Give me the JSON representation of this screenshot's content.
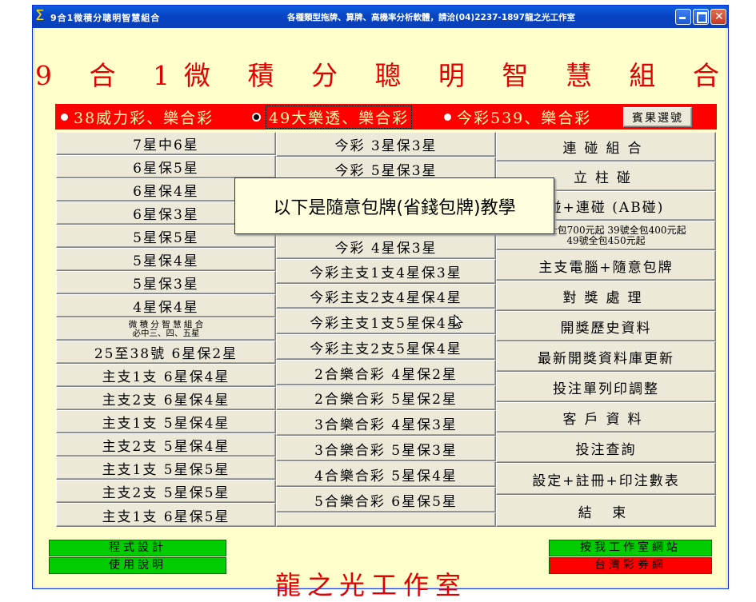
{
  "window": {
    "title": "9合1微積分聰明智慧組合",
    "subtitle": "各種類型拖牌、算牌、高機率分析軟體，請洽(04)2237-1897龍之光工作室",
    "app_icon": "sigma-icon"
  },
  "heading": "9 合 1微 積 分 聰 明 智 慧 組 合",
  "radios": [
    {
      "label": "38威力彩、樂合彩",
      "selected": false
    },
    {
      "label": "49大樂透、樂合彩",
      "selected": true
    },
    {
      "label": "今彩539、樂合彩",
      "selected": false
    }
  ],
  "result_button": "賓果選號",
  "tooltip": "以下是隨意包牌(省錢包牌)教學",
  "col1": [
    "7星中6星",
    "6星保5星",
    "6星保4星",
    "6星保3星",
    "5星保5星",
    "5星保4星",
    "5星保3星",
    "4星保4星",
    "微 積 分 智 慧 組 合",
    "必中三、四、五星",
    "25至38號 6星保2星",
    "主支1支  6星保4星",
    "主支2支  6星保4星",
    "主支1支  5星保4星",
    "主支2支  5星保4星",
    "主支1支  5星保5星",
    "主支2支  5星保5星",
    "主支1支  6星保5星"
  ],
  "col2": [
    "今彩 3星保3星",
    "今彩 5星保3星",
    "今彩 4星保3星",
    "今彩主支1支4星保3星",
    "今彩主支2支4星保4星",
    "今彩主支1支5星保4星",
    "今彩主支2支5星保4星",
    "2合樂合彩  4星保2星",
    "2合樂合彩  5星保2星",
    "3合樂合彩  4星保3星",
    "3合樂合彩  5星保3星",
    "4合樂合彩  5星保4星",
    "5合樂合彩  6星保5星"
  ],
  "col3": [
    "連碰組合",
    "立柱碰",
    "碰+連碰 (AB碰)",
    "38號全包700元起 39號全包400元起",
    "49號全包450元起",
    "主支電腦+隨意包牌",
    "對獎處理",
    "開獎歷史資料",
    "最新開獎資料庫更新",
    "投注單列印調整",
    "客戶資料",
    "投注查詢",
    "設定+註冊+印注數表",
    "結  束"
  ],
  "bottom": {
    "program_design": "程式設計",
    "instructions": "使用說明",
    "studio_name": "龍之光工作室",
    "visit_site": "按我工作室網站",
    "taiwan_lottery": "台灣彩券網"
  },
  "colors": {
    "title_red": "#e00000",
    "radio_bar": "#ff0000",
    "client_bg": "#ffffcc",
    "green_button": "#00cc00"
  }
}
